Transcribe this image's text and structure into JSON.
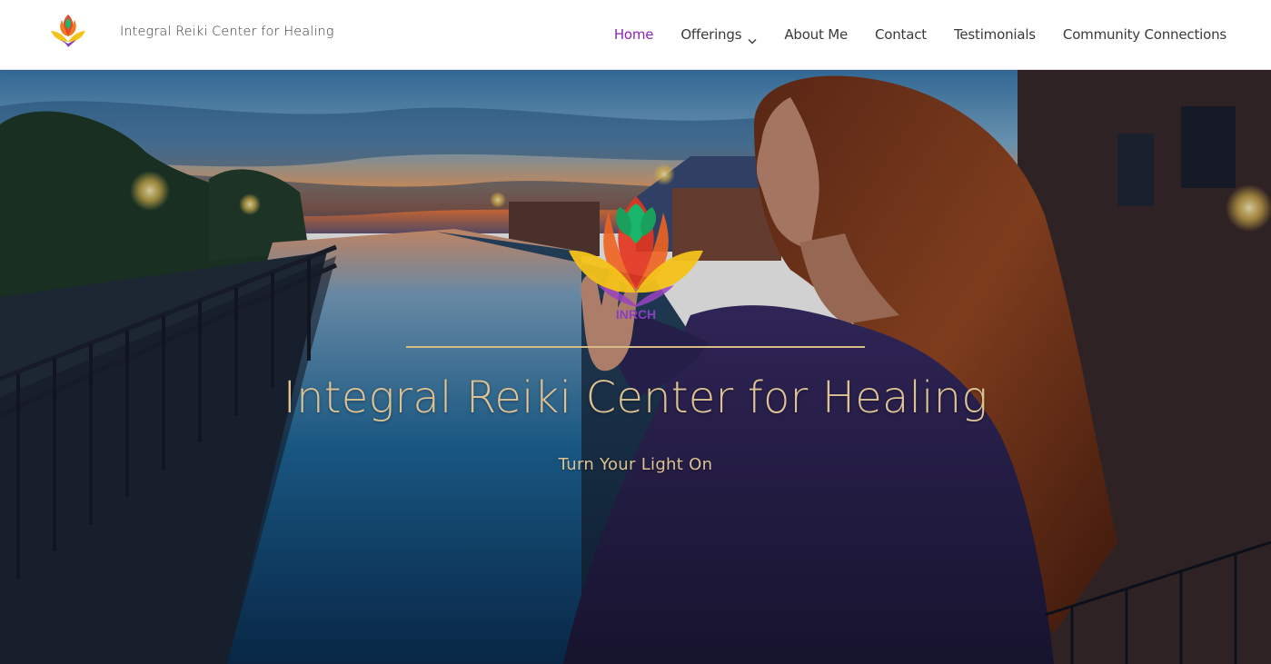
{
  "header": {
    "site_title": "Integral Reiki Center for Healing",
    "logo_icon": "lotus-logo-icon"
  },
  "nav": {
    "items": [
      {
        "label": "Home",
        "active": true
      },
      {
        "label": "Offerings",
        "has_dropdown": true
      },
      {
        "label": "About Me"
      },
      {
        "label": "Contact"
      },
      {
        "label": "Testimonials"
      },
      {
        "label": "Community Connections"
      }
    ]
  },
  "hero": {
    "logo_text": "INRCH",
    "title": "Integral Reiki Center for Healing",
    "tagline": "Turn Your Light On"
  },
  "colors": {
    "accent": "#8f22c2",
    "hero_text": "#ddc294",
    "nav_text": "#3a3a3a"
  }
}
